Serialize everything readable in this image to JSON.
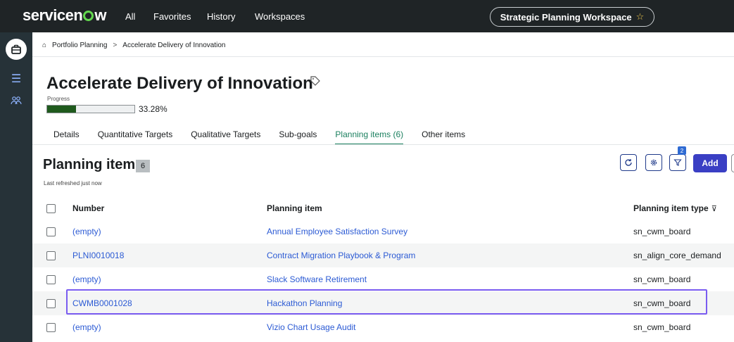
{
  "topbar": {
    "logo": "servicenow",
    "nav": [
      "All",
      "Favorites",
      "History",
      "Workspaces"
    ],
    "workspace": "Strategic Planning Workspace"
  },
  "breadcrumb": {
    "items": [
      "Portfolio Planning",
      "Accelerate Delivery of Innovation"
    ],
    "separator": ">"
  },
  "page": {
    "title": "Accelerate Delivery of Innovation",
    "progress_label": "Progress",
    "progress_value": "33.28%",
    "progress_fraction": 0.3328
  },
  "tabs": [
    "Details",
    "Quantitative Targets",
    "Qualitative Targets",
    "Sub-goals",
    "Planning items (6)",
    "Other items"
  ],
  "active_tab": "Planning items (6)",
  "section": {
    "title": "Planning items",
    "count": "6",
    "refreshed": "Last refreshed just now",
    "filter_count": "2",
    "add_label": "Add"
  },
  "table": {
    "headers": {
      "number": "Number",
      "item": "Planning item",
      "type": "Planning item type"
    },
    "rows": [
      {
        "number": "(empty)",
        "item": "Annual Employee Satisfaction Survey",
        "type": "sn_cwm_board"
      },
      {
        "number": "PLNI0010018",
        "item": "Contract Migration Playbook & Program",
        "type": "sn_align_core_demand"
      },
      {
        "number": "(empty)",
        "item": "Slack Software Retirement",
        "type": "sn_cwm_board"
      },
      {
        "number": "CWMB0001028",
        "item": "Hackathon Planning",
        "type": "sn_cwm_board"
      },
      {
        "number": "(empty)",
        "item": "Vizio Chart Usage Audit",
        "type": "sn_cwm_board"
      }
    ]
  },
  "colors": {
    "topbar": "#1f2426",
    "rail": "#263238",
    "accent_tab": "#1a7f5e",
    "link": "#2b5ad4",
    "add_button": "#3a3fc4",
    "highlight": "#7a5cf0",
    "progress_fill": "#1f5a1d"
  }
}
